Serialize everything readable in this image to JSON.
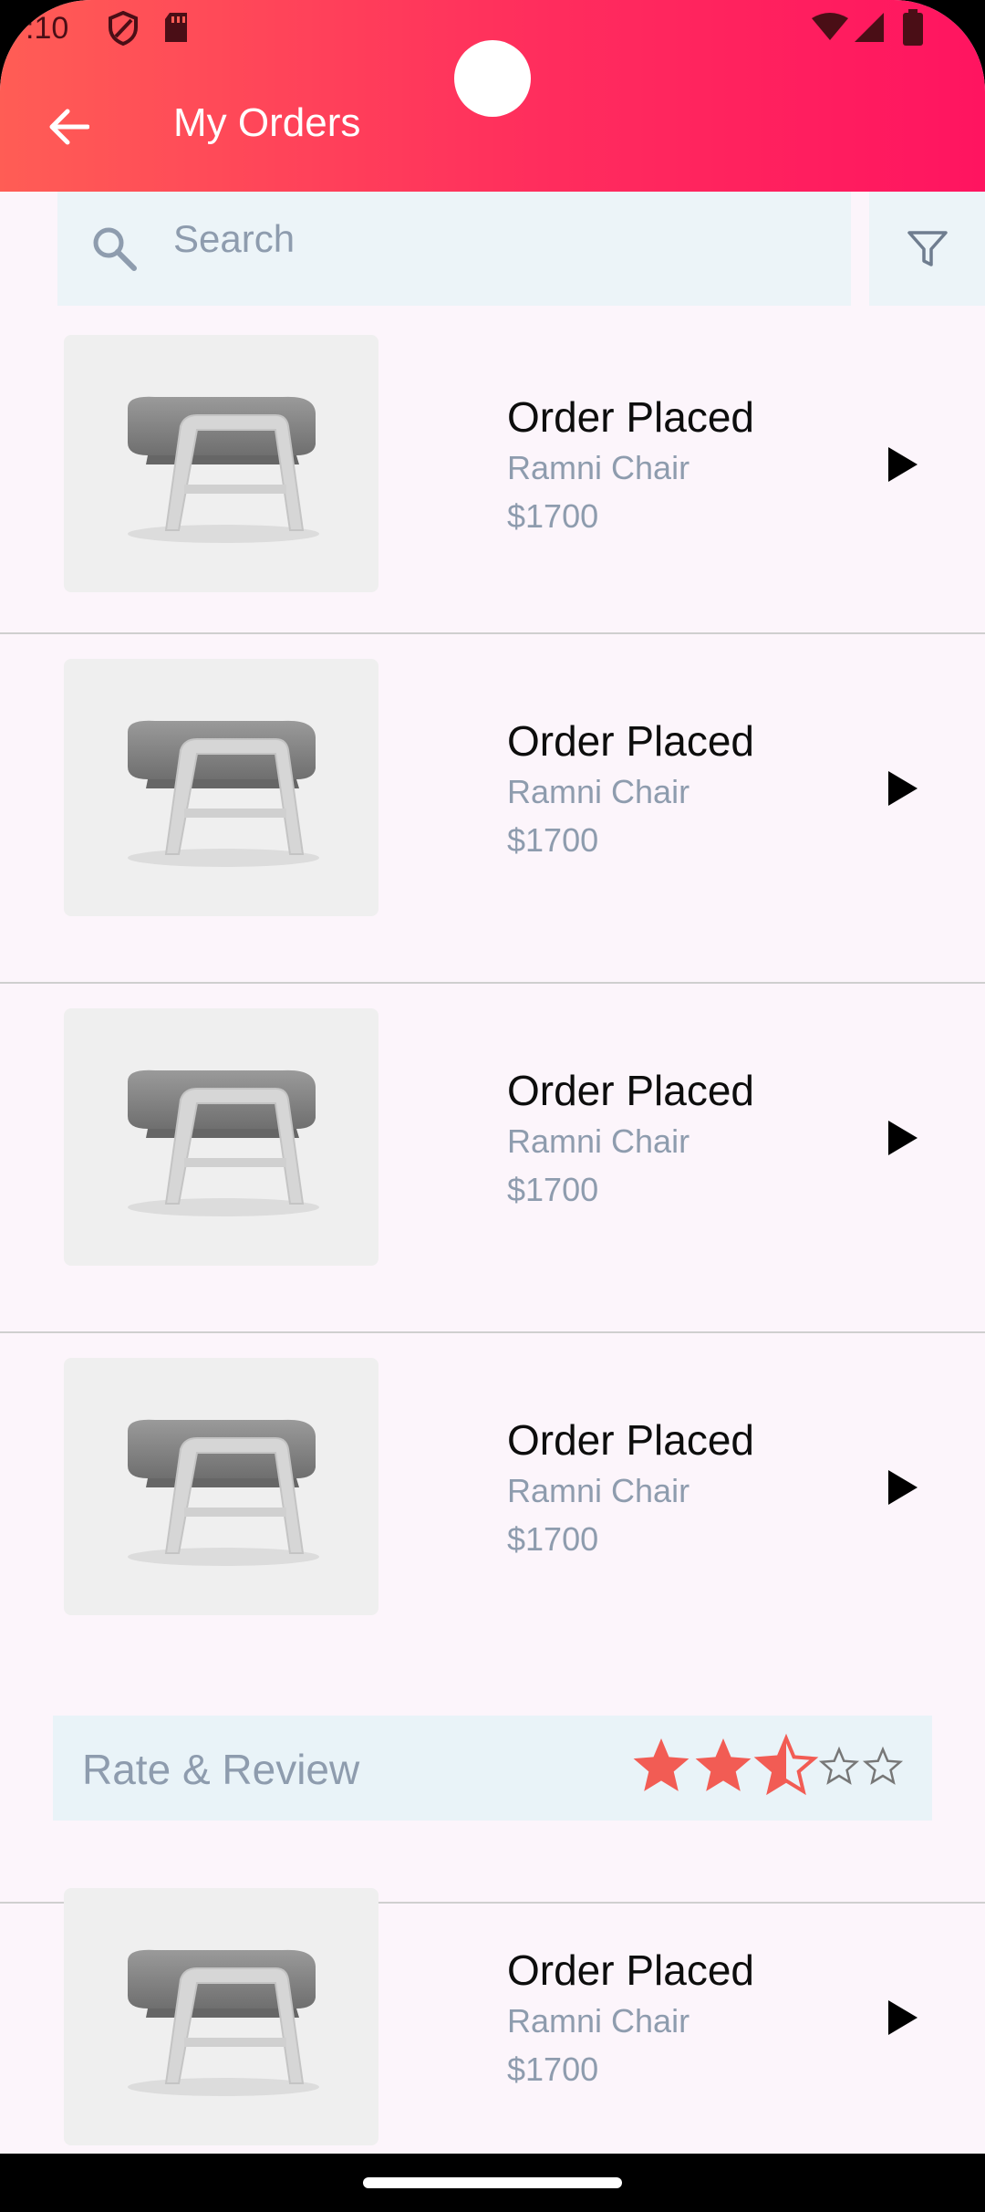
{
  "status_bar": {
    "time": ":10"
  },
  "header": {
    "title": "My Orders"
  },
  "search": {
    "placeholder": "Search"
  },
  "orders": [
    {
      "status": "Order Placed",
      "name": "Ramni Chair",
      "price": "$1700"
    },
    {
      "status": "Order Placed",
      "name": "Ramni Chair",
      "price": "$1700"
    },
    {
      "status": "Order Placed",
      "name": "Ramni Chair",
      "price": "$1700"
    },
    {
      "status": "Order Placed",
      "name": "Ramni Chair",
      "price": "$1700"
    },
    {
      "status": "Order Placed",
      "name": "Ramni Chair",
      "price": "$1700"
    }
  ],
  "review": {
    "label": "Rate & Review",
    "rating": 2.5,
    "max_rating": 5
  },
  "colors": {
    "header_start": "#ff5d55",
    "header_end": "#ff1460",
    "star_filled": "#f25c54",
    "muted_text": "#8e9cae"
  },
  "icons": [
    "back-arrow-icon",
    "search-icon",
    "filter-icon",
    "play-arrow-icon",
    "star-icon",
    "chair-image"
  ]
}
